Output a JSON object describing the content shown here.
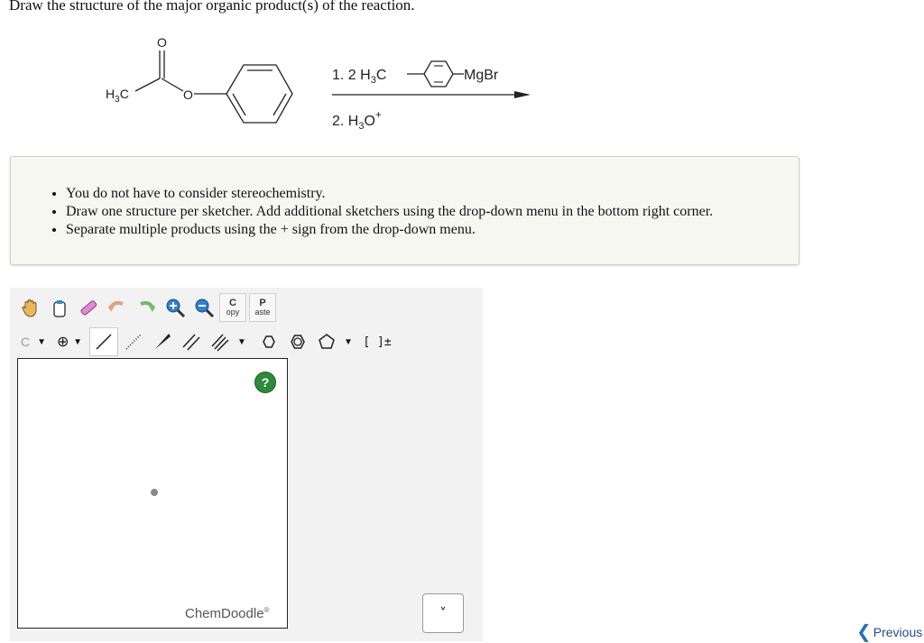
{
  "question": {
    "title": "Draw the structure of the major organic product(s) of the reaction."
  },
  "reaction": {
    "reactant_methyl_label": "H3C",
    "reactant_oxygen_carbonyl": "O",
    "reactant_oxygen_ester": "O",
    "step1_prefix": "1. 2 H3C",
    "step1_reagent_suffix": "MgBr",
    "step2": "2. H3O+"
  },
  "instructions": [
    "You do not have to consider stereochemistry.",
    "Draw one structure per sketcher. Add additional sketchers using the drop-down menu in the bottom right corner.",
    "Separate multiple products using the + sign from the drop-down menu."
  ],
  "toolbar": {
    "copy_top": "C",
    "copy_bottom": "opy",
    "paste_top": "P",
    "paste_bottom": "aste",
    "atom_label": "C",
    "charge_label": "⊕",
    "bracket_label": "[ ]±"
  },
  "sketcher": {
    "help_label": "?",
    "brand": "ChemDoodle",
    "brand_mark": "®"
  },
  "select_symbol": "˅",
  "nav": {
    "previous_label": "Previous"
  }
}
